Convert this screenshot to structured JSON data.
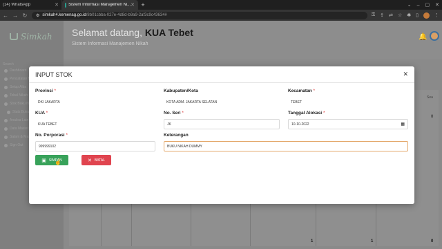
{
  "browser": {
    "tabs": [
      {
        "title": "(14) WhatsApp",
        "active": false
      },
      {
        "title": "Sistem Informasi Manajemen Ni...",
        "active": true
      }
    ],
    "url_host": "simkah4.kemenag.go.id",
    "url_path": "/8b01cbba-027e-4d8d-b9a9-2af3c9c43634#"
  },
  "app": {
    "logo_text": "Simkah",
    "welcome_prefix": "Selamat datang,",
    "welcome_name": "KUA Tebet",
    "subtitle": "Sistem Informasi Manajemen Nikah"
  },
  "sidebar": {
    "search": "Search",
    "items": [
      "Dashboard",
      "Pencatatan Nik...",
      "Setup Alba",
      "Tebal Nikah",
      "Stok Buku Nik...",
      "Stats Buku Nik...",
      "Analisa Lain",
      "Data Master",
      "Salam & Masta...",
      "Sign Out"
    ]
  },
  "background_table": {
    "col_head": "Sea",
    "top_value": "0",
    "totals": [
      "1",
      "1",
      "0"
    ]
  },
  "modal": {
    "title": "INPUT STOK",
    "fields": {
      "provinsi": {
        "label": "Provinsi",
        "required": "*",
        "value": "DKI JAKARTA"
      },
      "kabupaten": {
        "label": "Kabupaten/Kota",
        "required": "",
        "value": "KOTA ADM. JAKARTA SELATAN"
      },
      "kecamatan": {
        "label": "Kecamatan",
        "required": "*",
        "value": "TEBET"
      },
      "kua": {
        "label": "KUA",
        "required": "*",
        "value": "KUA TEBET"
      },
      "no_seri": {
        "label": "No. Seri",
        "required": "*",
        "value": "JK"
      },
      "tanggal": {
        "label": "Tanggal Alokasi",
        "required": "*",
        "value": "10-10-2022"
      },
      "porporasi": {
        "label": "No. Porporasi",
        "required": "*",
        "value": "999999102"
      },
      "keterangan": {
        "label": "Keterangan",
        "required": "",
        "value": "BUKU NIKAH DUMMY"
      }
    },
    "save_label": "SIMPAN",
    "cancel_label": "BATAL"
  }
}
